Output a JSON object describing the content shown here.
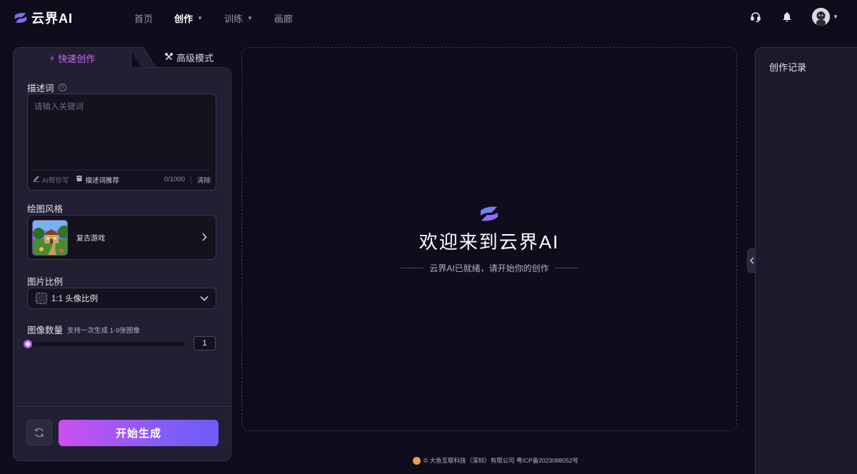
{
  "app": {
    "name": "云界AI",
    "brand_gradient": [
      "#3a8cf5",
      "#c84ff0"
    ]
  },
  "nav": {
    "items": [
      {
        "label": "首页",
        "active": false,
        "has_dropdown": false
      },
      {
        "label": "创作",
        "active": true,
        "has_dropdown": true
      },
      {
        "label": "训练",
        "active": false,
        "has_dropdown": true
      },
      {
        "label": "画廊",
        "active": false,
        "has_dropdown": false
      }
    ],
    "right_icons": [
      "headset-icon",
      "bell-icon",
      "avatar"
    ]
  },
  "left_panel": {
    "tabs": [
      {
        "label": "快速创作",
        "icon": "lightning-icon",
        "active": true
      },
      {
        "label": "高级模式",
        "icon": "tools-icon",
        "active": false
      }
    ],
    "prompt": {
      "label": "描述词",
      "placeholder": "请输入关键词",
      "value": "",
      "ai_write_label": "AI帮你写",
      "recommend_label": "描述词推荐",
      "char_count": "0/1000",
      "clear_label": "清除"
    },
    "style": {
      "label": "绘图风格",
      "selected_name": "复古游戏"
    },
    "ratio": {
      "label": "图片比例",
      "selected": "1:1 头像比例"
    },
    "count": {
      "label": "图像数量",
      "hint": "支持一次生成 1-9张图像",
      "value": "1",
      "min": 1,
      "max": 9
    },
    "generate_label": "开始生成"
  },
  "canvas": {
    "welcome_title": "欢迎来到云界AI",
    "welcome_subtitle": "云界AI已就绪，请开始你的创作"
  },
  "right_panel": {
    "title": "创作记录"
  },
  "footer": {
    "text": "© 大鱼互联科技（深圳）有限公司 粤ICP备2023088052号"
  },
  "colors": {
    "background": "#0f0c1c",
    "panel": "#221f33",
    "accent": "#c86bf5",
    "button_gradient": [
      "#cc4ff0",
      "#6a5cf8"
    ]
  }
}
